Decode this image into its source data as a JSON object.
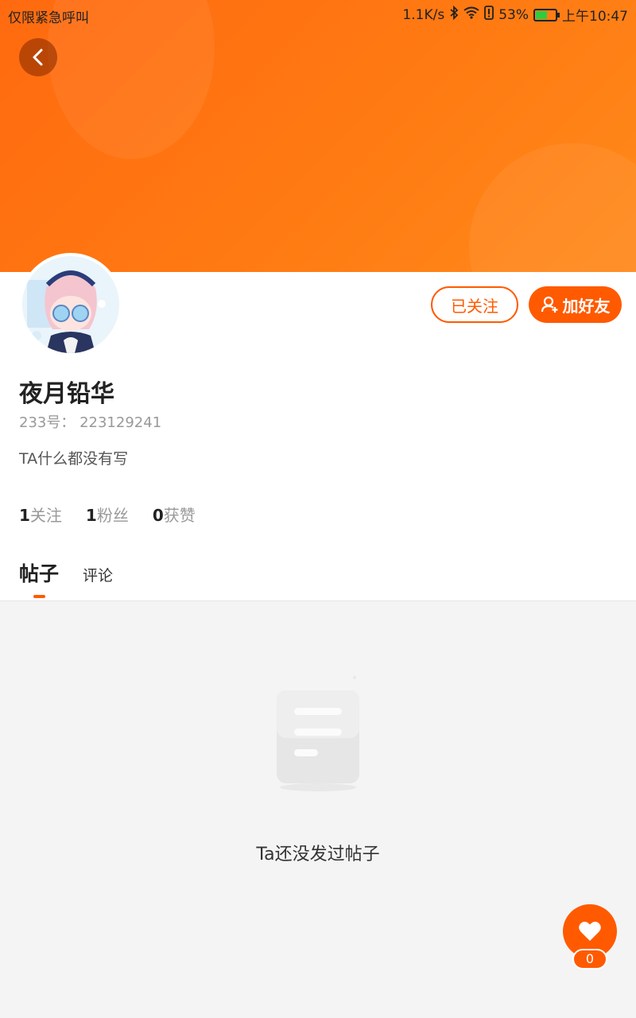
{
  "status_bar": {
    "carrier": "仅限紧急呼叫",
    "speed": "1.1K/s",
    "battery": "53%",
    "time": "上午10:47"
  },
  "profile": {
    "name": "夜月铅华",
    "uid": "233号： 223129241",
    "bio": "TA什么都没有写",
    "follow_label": "已关注",
    "add_friend_label": "加好友"
  },
  "stats": [
    {
      "num": "1",
      "label": "关注"
    },
    {
      "num": "1",
      "label": "粉丝"
    },
    {
      "num": "0",
      "label": "获赞"
    }
  ],
  "tabs": {
    "posts": "帖子",
    "comments": "评论"
  },
  "empty": {
    "text": "Ta还没发过帖子"
  },
  "like": {
    "count": "0"
  },
  "colors": {
    "accent": "#ff5a00",
    "header": "#ff7a12"
  },
  "icons": [
    "back-arrow-icon",
    "bluetooth-icon",
    "wifi-icon",
    "alert-icon",
    "battery-icon",
    "add-user-icon",
    "document-icon",
    "heart-icon"
  ]
}
